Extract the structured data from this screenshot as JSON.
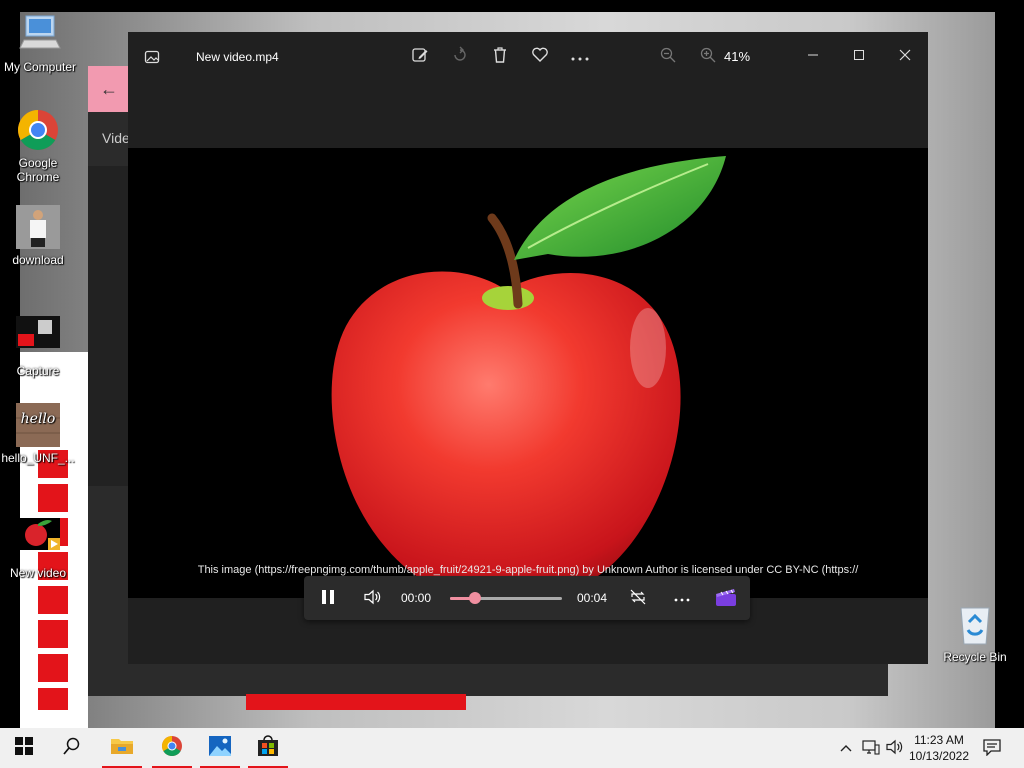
{
  "desktop": {
    "icons": [
      {
        "label": "My Computer",
        "icon": "computer-icon"
      },
      {
        "label": "Google Chrome",
        "icon": "chrome-icon"
      },
      {
        "label": "download",
        "icon": "image-file-icon"
      },
      {
        "label": "Capture",
        "icon": "image-file-icon"
      },
      {
        "label": "hello_UNF_...",
        "icon": "image-file-icon"
      },
      {
        "label": "New video",
        "icon": "video-file-icon"
      },
      {
        "label": "Recycle Bin",
        "icon": "recycle-bin-icon"
      }
    ]
  },
  "background_window": {
    "label": "Vide"
  },
  "photos_app": {
    "title": "New video.mp4",
    "zoom": "41%",
    "toolbar": [
      "edit-icon",
      "rotate-icon",
      "delete-icon",
      "favorite-icon",
      "more-icon",
      "zoom-out-icon",
      "zoom-in-icon"
    ],
    "caption": "This image (https://freepngimg.com/thumb/apple_fruit/24921-9-apple-fruit.png) by Unknown Author is licensed under CC BY-NC (https://",
    "player": {
      "current_time": "00:00",
      "duration": "00:04",
      "progress": 0.22
    }
  },
  "taskbar": {
    "apps": [
      "start-icon",
      "search-icon",
      "file-explorer-icon",
      "chrome-icon",
      "photos-icon",
      "store-icon"
    ],
    "time": "11:23 AM",
    "date": "10/13/2022"
  },
  "colors": {
    "accent_pink": "#f08fa0",
    "taskbar_underline": "#e3141a",
    "app_bg": "#202020"
  }
}
